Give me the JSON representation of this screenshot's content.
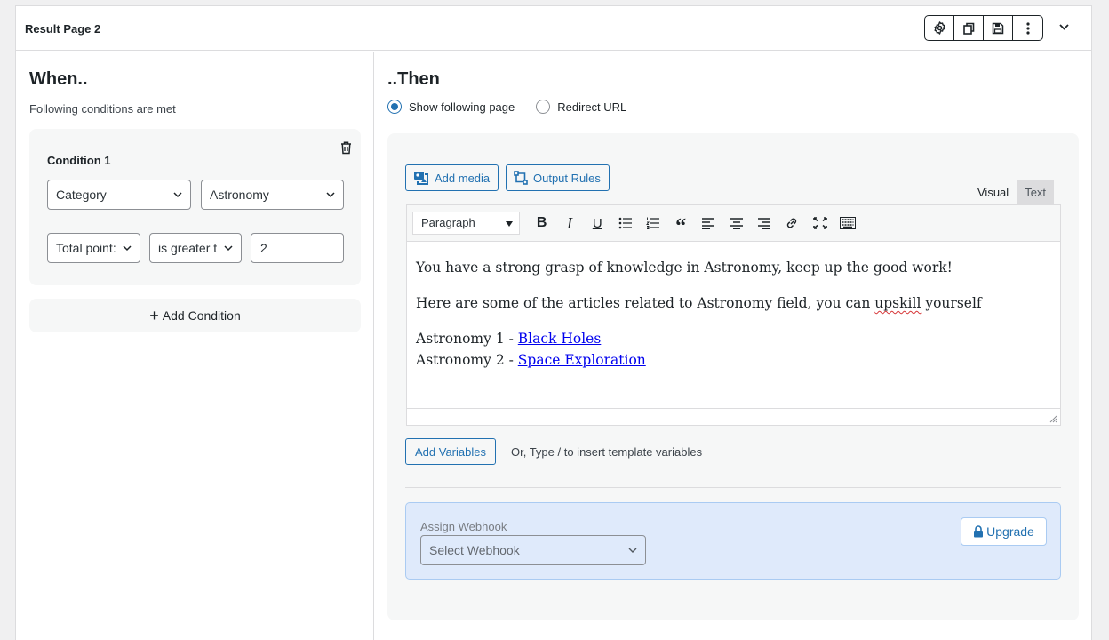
{
  "header": {
    "title": "Result Page 2"
  },
  "left": {
    "heading": "When..",
    "subtitle": "Following conditions are met",
    "condition": {
      "title": "Condition 1",
      "field1": "Category",
      "field2": "Astronomy",
      "field3": "Total point:",
      "operator": "is greater t",
      "value": "2"
    },
    "add_condition": "Add Condition"
  },
  "right": {
    "heading": "..Then",
    "radio_show": "Show following page",
    "radio_redirect": "Redirect URL",
    "add_media": "Add media",
    "output_rules": "Output Rules",
    "tab_visual": "Visual",
    "tab_text": "Text",
    "format": "Paragraph",
    "body": {
      "line1": "You have a strong grasp of knowledge in Astronomy, keep up the good work!",
      "line2_pre": "Here are some of the articles related to Astronomy field, you can ",
      "line2_word": "upskill",
      "line2_post": " yourself",
      "item1_pre": "Astronomy 1 - ",
      "item1_link": "Black Holes",
      "item2_pre": "Astronomy 2 - ",
      "item2_link": "Space Exploration"
    },
    "add_variables": "Add Variables",
    "hint": "Or, Type / to insert template variables",
    "webhook_label": "Assign Webhook",
    "webhook_placeholder": "Select Webhook",
    "upgrade": "Upgrade"
  }
}
